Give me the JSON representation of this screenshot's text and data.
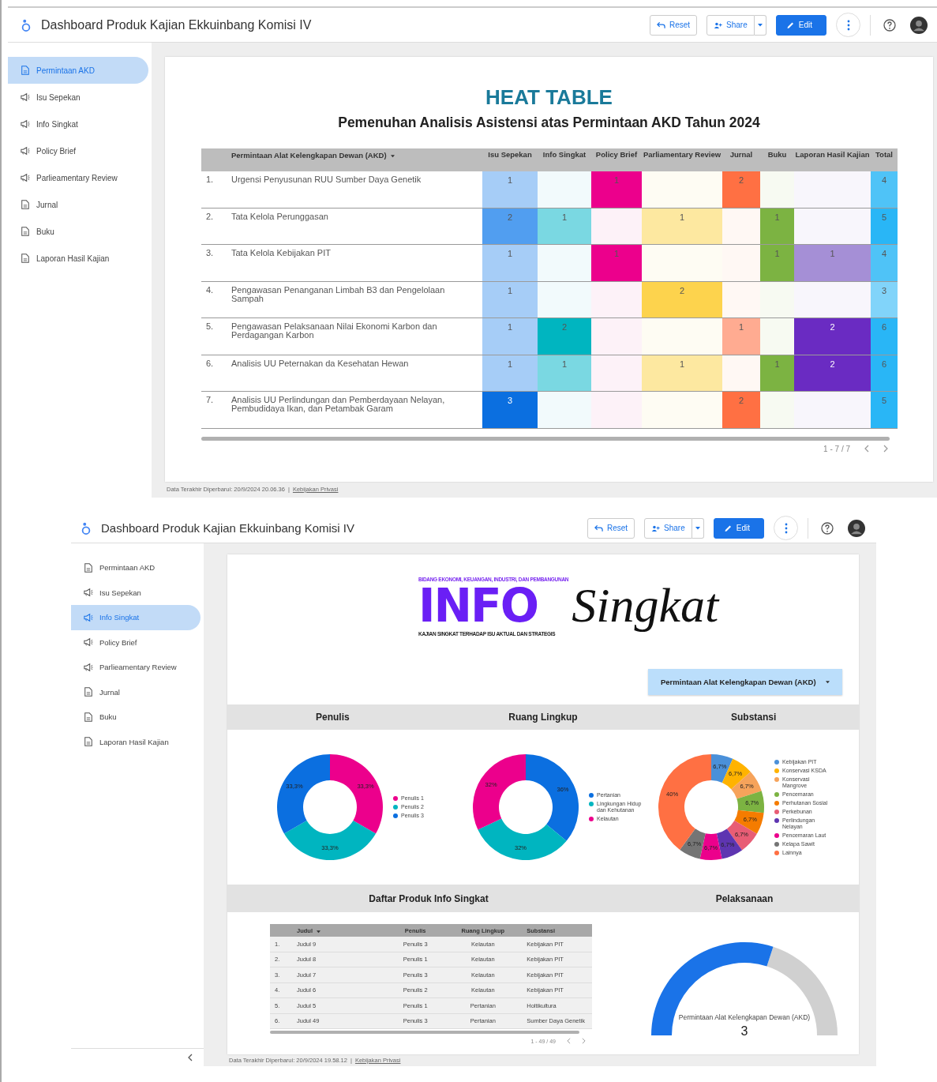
{
  "screens": [
    {
      "kind": "heat",
      "header": {
        "title": "Dashboard Produk Kajian Ekkuinbang Komisi IV",
        "buttons": [
          {
            "kind": "reset",
            "label": "Reset"
          },
          {
            "kind": "share",
            "label": "Share"
          },
          {
            "kind": "edit",
            "label": "Edit"
          }
        ]
      },
      "sidebar": {
        "items": [
          {
            "kind": "doc",
            "label": "Permintaan AKD",
            "selected": true
          },
          {
            "kind": "megaphone",
            "label": "Isu Sepekan",
            "selected": false
          },
          {
            "kind": "megaphone",
            "label": "Info Singkat",
            "selected": false
          },
          {
            "kind": "megaphone",
            "label": "Policy Brief",
            "selected": false
          },
          {
            "kind": "megaphone",
            "label": "Parlieamentary Review",
            "selected": false
          },
          {
            "kind": "doc",
            "label": "Jurnal",
            "selected": false
          },
          {
            "kind": "doc",
            "label": "Buku",
            "selected": false
          },
          {
            "kind": "doc",
            "label": "Laporan Hasil Kajian",
            "selected": false
          }
        ]
      },
      "report": {
        "title": "HEAT TABLE",
        "subtitle": "Pemenuhan Analisis Asistensi atas Permintaan AKD Tahun 2024",
        "table": {
          "columns": [
            {
              "label": "Permintaan Alat Kelengkapan Dewan (AKD)",
              "sorted": true
            },
            {
              "label": "Isu Sepekan",
              "sorted": false
            },
            {
              "label": "Info Singkat",
              "sorted": false
            },
            {
              "label": "Policy Brief",
              "sorted": false
            },
            {
              "label": "Parliamentary Review",
              "sorted": false
            },
            {
              "label": "Jurnal",
              "sorted": false
            },
            {
              "label": "Buku",
              "sorted": false
            },
            {
              "label": "Laporan Hasil Kajian",
              "sorted": false
            },
            {
              "label": "Total",
              "sorted": false
            }
          ],
          "rows": [
            {
              "index": "1.",
              "cells": [
                {
                  "value": "Urgensi Penyusunan RUU Sumber Daya Genetik"
                },
                {
                  "value": "1",
                  "color": "#a6cdf7"
                },
                {
                  "color": "#f2fafc"
                },
                {
                  "value": "1",
                  "color": "#ec008c"
                },
                {
                  "color": "#fefcf3"
                },
                {
                  "value": "2",
                  "color": "#ff7043"
                },
                {
                  "color": "#f7faf2"
                },
                {
                  "color": "#f8f6fc"
                },
                {
                  "value": "4",
                  "color": "#4fc3f7"
                }
              ]
            },
            {
              "index": "2.",
              "cells": [
                {
                  "value": "Tata Kelola Perunggasan"
                },
                {
                  "value": "2",
                  "color": "#519ef0"
                },
                {
                  "value": "1",
                  "color": "#7ad8e2"
                },
                {
                  "color": "#fdf2f8"
                },
                {
                  "value": "1",
                  "color": "#fde8a0"
                },
                {
                  "color": "#fff8f4"
                },
                {
                  "value": "1",
                  "color": "#7cb342"
                },
                {
                  "color": "#f8f6fc"
                },
                {
                  "value": "5",
                  "color": "#29b6f6"
                }
              ]
            },
            {
              "index": "3.",
              "cells": [
                {
                  "value": "Tata Kelola Kebijakan PIT"
                },
                {
                  "value": "1",
                  "color": "#a6cdf7"
                },
                {
                  "color": "#f2fafc"
                },
                {
                  "value": "1",
                  "color": "#ec008c"
                },
                {
                  "color": "#fefcf3"
                },
                {
                  "color": "#fff8f4"
                },
                {
                  "value": "1",
                  "color": "#7cb342"
                },
                {
                  "value": "1",
                  "color": "#a58fd6"
                },
                {
                  "value": "4",
                  "color": "#4fc3f7"
                }
              ]
            },
            {
              "index": "4.",
              "cells": [
                {
                  "value": "Pengawasan Penanganan Limbah B3 dan Pengelolaan Sampah"
                },
                {
                  "value": "1",
                  "color": "#a6cdf7"
                },
                {
                  "color": "#f2fafc"
                },
                {
                  "color": "#fdf2f8"
                },
                {
                  "value": "2",
                  "color": "#fdd34d"
                },
                {
                  "color": "#fff8f4"
                },
                {
                  "color": "#f7faf2"
                },
                {
                  "color": "#f8f6fc"
                },
                {
                  "value": "3",
                  "color": "#81d4fa"
                }
              ]
            },
            {
              "index": "5.",
              "cells": [
                {
                  "value": "Pengawasan Pelaksanaan Nilai Ekonomi Karbon dan Perdagangan Karbon"
                },
                {
                  "value": "1",
                  "color": "#a6cdf7"
                },
                {
                  "value": "2",
                  "color": "#00b5c0"
                },
                {
                  "color": "#fdf2f8"
                },
                {
                  "color": "#fefcf3"
                },
                {
                  "value": "1",
                  "color": "#ffab91"
                },
                {
                  "color": "#f7faf2"
                },
                {
                  "value": "2",
                  "color": "#6a2bc2"
                },
                {
                  "value": "6",
                  "color": "#29b6f6"
                }
              ]
            },
            {
              "index": "6.",
              "cells": [
                {
                  "value": "Analisis UU Peternakan da Kesehatan Hewan"
                },
                {
                  "value": "1",
                  "color": "#a6cdf7"
                },
                {
                  "value": "1",
                  "color": "#7ad8e2"
                },
                {
                  "color": "#fdf2f8"
                },
                {
                  "value": "1",
                  "color": "#fde8a0"
                },
                {
                  "color": "#fff8f4"
                },
                {
                  "value": "1",
                  "color": "#7cb342"
                },
                {
                  "value": "2",
                  "color": "#6a2bc2"
                },
                {
                  "value": "6",
                  "color": "#29b6f6"
                }
              ]
            },
            {
              "index": "7.",
              "cells": [
                {
                  "value": "Analisis UU Perlindungan dan Pemberdayaan Nelayan, Pembudidaya Ikan, dan Petambak Garam"
                },
                {
                  "value": "3",
                  "color": "#0b6fe0"
                },
                {
                  "color": "#f2fafc"
                },
                {
                  "color": "#fdf2f8"
                },
                {
                  "color": "#fefcf3"
                },
                {
                  "value": "2",
                  "color": "#ff7043"
                },
                {
                  "color": "#f7faf2"
                },
                {
                  "color": "#f8f6fc"
                },
                {
                  "value": "5",
                  "color": "#29b6f6"
                }
              ]
            }
          ]
        },
        "pagination": "1 - 7 / 7"
      },
      "footer": {
        "updated": "Data Terakhir Diperbarui: 20/9/2024 20.06.36",
        "separator": "|",
        "privacy": "Kebijakan Privasi"
      }
    },
    {
      "kind": "info",
      "header": {
        "title": "Dashboard Produk Kajian Ekkuinbang Komisi IV",
        "buttons": [
          {
            "kind": "reset",
            "label": "Reset"
          },
          {
            "kind": "share",
            "label": "Share"
          },
          {
            "kind": "edit",
            "label": "Edit"
          }
        ]
      },
      "sidebar": {
        "items": [
          {
            "kind": "doc",
            "label": "Permintaan AKD",
            "selected": false
          },
          {
            "kind": "megaphone",
            "label": "Isu Sepekan",
            "selected": false
          },
          {
            "kind": "megaphone",
            "label": "Info Singkat",
            "selected": true
          },
          {
            "kind": "megaphone",
            "label": "Policy Brief",
            "selected": false
          },
          {
            "kind": "megaphone",
            "label": "Parlieamentary Review",
            "selected": false
          },
          {
            "kind": "doc",
            "label": "Jurnal",
            "selected": false
          },
          {
            "kind": "doc",
            "label": "Buku",
            "selected": false
          },
          {
            "kind": "doc",
            "label": "Laporan Hasil Kajian",
            "selected": false
          }
        ]
      },
      "report": {
        "logo": {
          "tagline_top": "BIDANG EKONOMI, KEUANGAN, INDUSTRI, DAN PEMBANGUNAN",
          "info": "INFO",
          "singkat": "Singkat",
          "tagline_bottom": "KAJIAN SINGKAT TERHADAP ISU AKTUAL DAN STRATEGIS"
        },
        "filter": {
          "label": "Permintaan Alat Kelengkapan Dewan (AKD)"
        },
        "charts": [
          {
            "chart_data": {
              "type": "donut",
              "title": "Penulis",
              "legend": "right",
              "categories": [
                "Penulis 1",
                "Penulis 2",
                "Penulis 3"
              ],
              "colors": [
                "#ec008c",
                "#00b5c0",
                "#0b6fe0"
              ],
              "values": [
                33.3,
                33.3,
                33.3
              ],
              "value_labels": [
                "33,3%",
                "33,3%",
                "33,3%"
              ]
            }
          },
          {
            "chart_data": {
              "type": "donut",
              "title": "Ruang Lingkup",
              "legend": "right",
              "categories": [
                "Pertanian",
                "Lingkungan Hidup dan Kehutanan",
                "Kelautan"
              ],
              "colors": [
                "#0b6fe0",
                "#00b5c0",
                "#ec008c"
              ],
              "values": [
                36,
                32,
                32
              ],
              "value_labels": [
                "36%",
                "32%",
                "32%"
              ]
            }
          },
          {
            "chart_data": {
              "type": "donut",
              "title": "Substansi",
              "legend": "right",
              "categories": [
                "Kebijakan PIT",
                "Konservasi KSDA",
                "Konservasi Mangrove",
                "Pencemaran",
                "Perhutanan Sosial",
                "Perkebunan",
                "Perlindungan Nelayan",
                "Pencemaran Laut",
                "Kelapa Sawit",
                "Lainnya"
              ],
              "colors": [
                "#4a90d9",
                "#ffb300",
                "#f6a35b",
                "#7cb342",
                "#f57c00",
                "#e85d75",
                "#5e35b1",
                "#ec008c",
                "#757575",
                "#ff7043"
              ],
              "values": [
                6.7,
                6.7,
                6.7,
                6.7,
                6.7,
                6.7,
                6.7,
                6.7,
                6.7,
                40
              ],
              "value_labels": [
                "6,7%",
                "6,7%",
                "6,7%",
                "6,7%",
                "6,7%",
                "6,7%",
                "6,7%",
                "6,7%",
                "6,7%",
                "40%"
              ]
            }
          }
        ],
        "list": {
          "title": "Daftar Produk Info Singkat",
          "columns": [
            {
              "label": "Judul",
              "sorted": true
            },
            {
              "label": "Penulis",
              "sorted": false
            },
            {
              "label": "Ruang Lingkup",
              "sorted": false
            },
            {
              "label": "Substansi",
              "sorted": false
            }
          ],
          "rows": [
            {
              "index": "1.",
              "cells": [
                "Judul 9",
                "Penulis 3",
                "Kelautan",
                "Kebijakan PIT"
              ]
            },
            {
              "index": "2.",
              "cells": [
                "Judul 8",
                "Penulis 1",
                "Kelautan",
                "Kebijakan PIT"
              ]
            },
            {
              "index": "3.",
              "cells": [
                "Judul 7",
                "Penulis 3",
                "Kelautan",
                "Kebijakan PIT"
              ]
            },
            {
              "index": "4.",
              "cells": [
                "Judul 6",
                "Penulis 2",
                "Kelautan",
                "Kebijakan PIT"
              ]
            },
            {
              "index": "5.",
              "cells": [
                "Judul 5",
                "Penulis 1",
                "Pertanian",
                "Holtikultura"
              ]
            },
            {
              "index": "6.",
              "cells": [
                "Judul 49",
                "Penulis 3",
                "Pertanian",
                "Sumber Daya Genetik"
              ]
            }
          ],
          "pagination": "1 - 49 / 49"
        },
        "gauge": {
          "title": "Pelaksanaan",
          "label": "Permintaan Alat Kelengkapan Dewan (AKD)",
          "value": "3",
          "level": 0.6
        }
      },
      "footer": {
        "updated": "Data Terakhir Diperbarui: 20/9/2024 19.58.12",
        "separator": "|",
        "privacy": "Kebijakan Privasi"
      }
    }
  ]
}
